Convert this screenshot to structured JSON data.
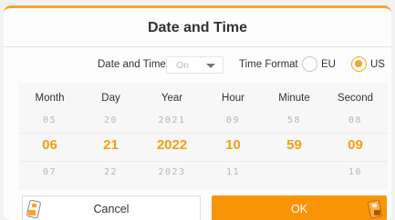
{
  "dialog": {
    "title": "Date and Time"
  },
  "settings": {
    "date_and_time_label": "Date and Time",
    "date_and_time_value": "On",
    "time_format_label": "Time Format",
    "options": [
      {
        "label": "EU",
        "selected": false
      },
      {
        "label": "US",
        "selected": true
      }
    ]
  },
  "picker": {
    "columns": [
      {
        "header": "Month",
        "prev": "05",
        "current": "06",
        "next": "07"
      },
      {
        "header": "Day",
        "prev": "20",
        "current": "21",
        "next": "22"
      },
      {
        "header": "Year",
        "prev": "2021",
        "current": "2022",
        "next": "2023"
      },
      {
        "header": "Hour",
        "prev": "09",
        "current": "10",
        "next": "11"
      },
      {
        "header": "Minute",
        "prev": "58",
        "current": "59",
        "next": ""
      },
      {
        "header": "Second",
        "prev": "08",
        "current": "09",
        "next": "10"
      }
    ]
  },
  "buttons": {
    "cancel_label": "Cancel",
    "ok_label": "OK"
  },
  "colors": {
    "accent": "#f89406",
    "selected_text": "#f5a012"
  }
}
